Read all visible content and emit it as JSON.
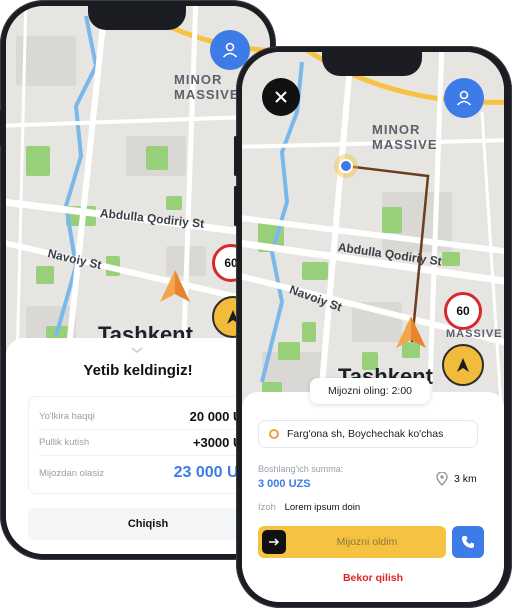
{
  "back_phone": {
    "map": {
      "district": "MINOR\nMASSIVE",
      "street1": "Abdulla Qodiriy St",
      "street2": "Navoiy St",
      "city": "Tashkent",
      "speed_limit": "60"
    },
    "sheet": {
      "title": "Yetib keldingiz!",
      "rows": [
        {
          "label": "Yo'lkira haqqi",
          "value": "20 000 UZS"
        },
        {
          "label": "Pullik kutish",
          "value": "+3000 UZS"
        },
        {
          "label": "Mijozdan olasiz",
          "value": "23 000 UZS"
        }
      ],
      "exit_button": "Chiqish"
    }
  },
  "front_phone": {
    "map": {
      "district": "MINOR\nMASSIVE",
      "street1": "Abdulla Qodiriy St",
      "street2": "Navoiy St",
      "city": "Tashkent",
      "massive2": "MASSIVE",
      "speed_limit": "60"
    },
    "pickup_timer": "Mijozni oling: 2:00",
    "address": "Farg'ona sh, Boychechak ko'chas",
    "start_sum_label": "Boshlang'ich summa:",
    "start_sum_value": "3 000 UZS",
    "distance": "3 km",
    "note_label": "Izoh",
    "note_value": "Lorem ipsum doin",
    "slider_label": "Mijozni oldim",
    "cancel_button": "Bekor qilish"
  },
  "colors": {
    "accent_blue": "#3d7be6",
    "yellow": "#f6c242",
    "cancel_red": "#e02424",
    "route_brown": "#6b3e1f",
    "park_green": "#98d07a"
  }
}
